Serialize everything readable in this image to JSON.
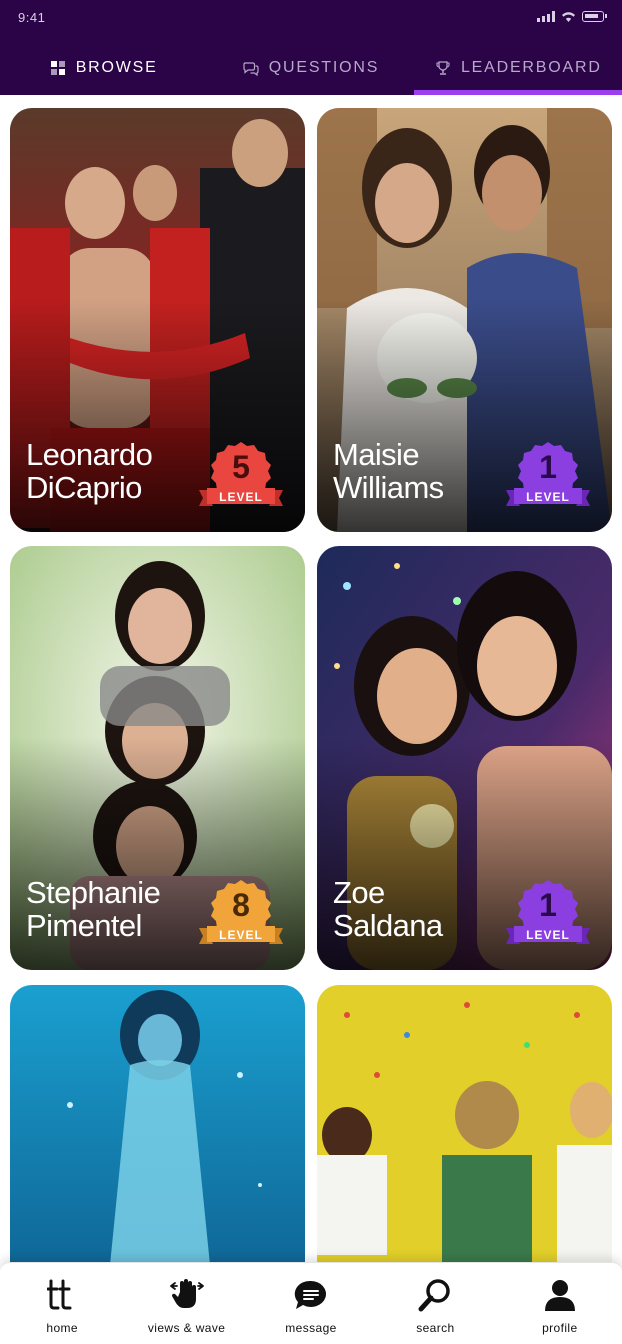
{
  "status_bar": {
    "time": "9:41"
  },
  "tabs": [
    {
      "label": "BROWSE",
      "icon": "grid-icon",
      "active": false
    },
    {
      "label": "QUESTIONS",
      "icon": "chat-bubbles-icon",
      "active": false
    },
    {
      "label": "LEADERBOARD",
      "icon": "trophy-icon",
      "active": true
    }
  ],
  "cards": [
    {
      "name_line1": "Leonardo",
      "name_line2": "DiCaprio",
      "level": "5",
      "level_label": "LEVEL",
      "badge_color": "#e8463f",
      "photo": "football-team-celebration"
    },
    {
      "name_line1": "Maisie",
      "name_line2": "Williams",
      "level": "1",
      "level_label": "LEVEL",
      "badge_color": "#8b3fe0",
      "photo": "wedding-couple"
    },
    {
      "name_line1": "Stephanie",
      "name_line2": "Pimentel",
      "level": "8",
      "level_label": "LEVEL",
      "badge_color": "#f0a43a",
      "photo": "three-smiling-girls"
    },
    {
      "name_line1": "Zoe",
      "name_line2": "Saldana",
      "level": "1",
      "level_label": "LEVEL",
      "badge_color": "#8b3fe0",
      "photo": "women-with-sparklers"
    },
    {
      "name_line1": "",
      "name_line2": "",
      "level": "",
      "level_label": "",
      "badge_color": "",
      "photo": "woman-underwater"
    },
    {
      "name_line1": "",
      "name_line2": "",
      "level": "",
      "level_label": "",
      "badge_color": "",
      "photo": "kids-with-confetti"
    }
  ],
  "bottom_nav": [
    {
      "label": "home",
      "icon": "tt-logo-icon"
    },
    {
      "label": "views & wave",
      "icon": "wave-hand-icon"
    },
    {
      "label": "message",
      "icon": "message-bubble-icon"
    },
    {
      "label": "search",
      "icon": "search-icon"
    },
    {
      "label": "profile",
      "icon": "person-icon"
    }
  ],
  "colors": {
    "header_bg": "#2a0446",
    "tab_underline": "#9b3df0"
  }
}
